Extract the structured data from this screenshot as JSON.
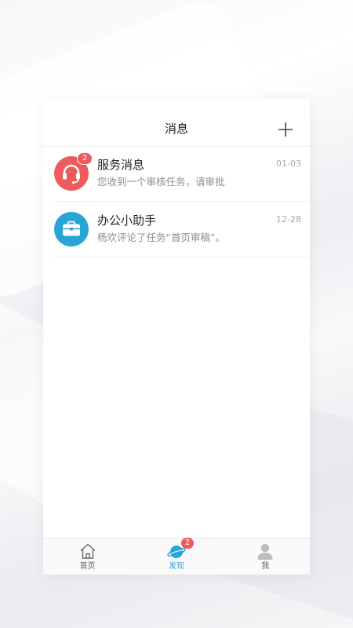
{
  "header": {
    "title": "消息",
    "add_icon": "plus-icon"
  },
  "messages": [
    {
      "title": "服务消息",
      "preview": "您收到一个审核任务，请审批",
      "time": "01-03",
      "badge": "2",
      "icon": "headset-icon",
      "color": "#ef5a5f"
    },
    {
      "title": "办公小助手",
      "preview": "杨欢评论了任务“首页审稿”。",
      "time": "12-28",
      "icon": "briefcase-icon",
      "color": "#27a5d6"
    }
  ],
  "tabbar": {
    "tabs": [
      {
        "label": "首页",
        "icon": "home-icon"
      },
      {
        "label": "发现",
        "icon": "discover-icon",
        "badge": "2",
        "active": true
      },
      {
        "label": "我",
        "icon": "profile-icon"
      }
    ]
  },
  "colors": {
    "accent": "#27a5d6",
    "badge": "#ef5a5f"
  }
}
